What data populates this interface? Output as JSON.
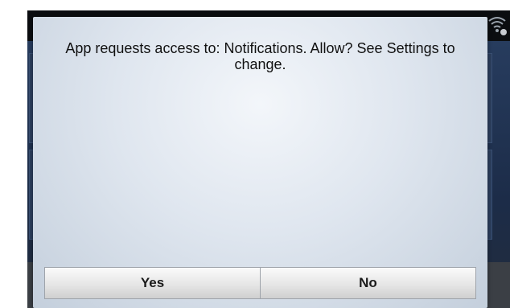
{
  "dialog": {
    "message": "App requests access to: Notifications. Allow? See Settings to change.",
    "buttons": {
      "yes_label": "Yes",
      "no_label": "No"
    }
  },
  "status_bar": {
    "icons": [
      "wifi-icon"
    ]
  },
  "colors": {
    "device_background": "#14171c",
    "dialog_background": "#dfe6ef",
    "button_background": "#e6e6e6",
    "text": "#111111"
  }
}
